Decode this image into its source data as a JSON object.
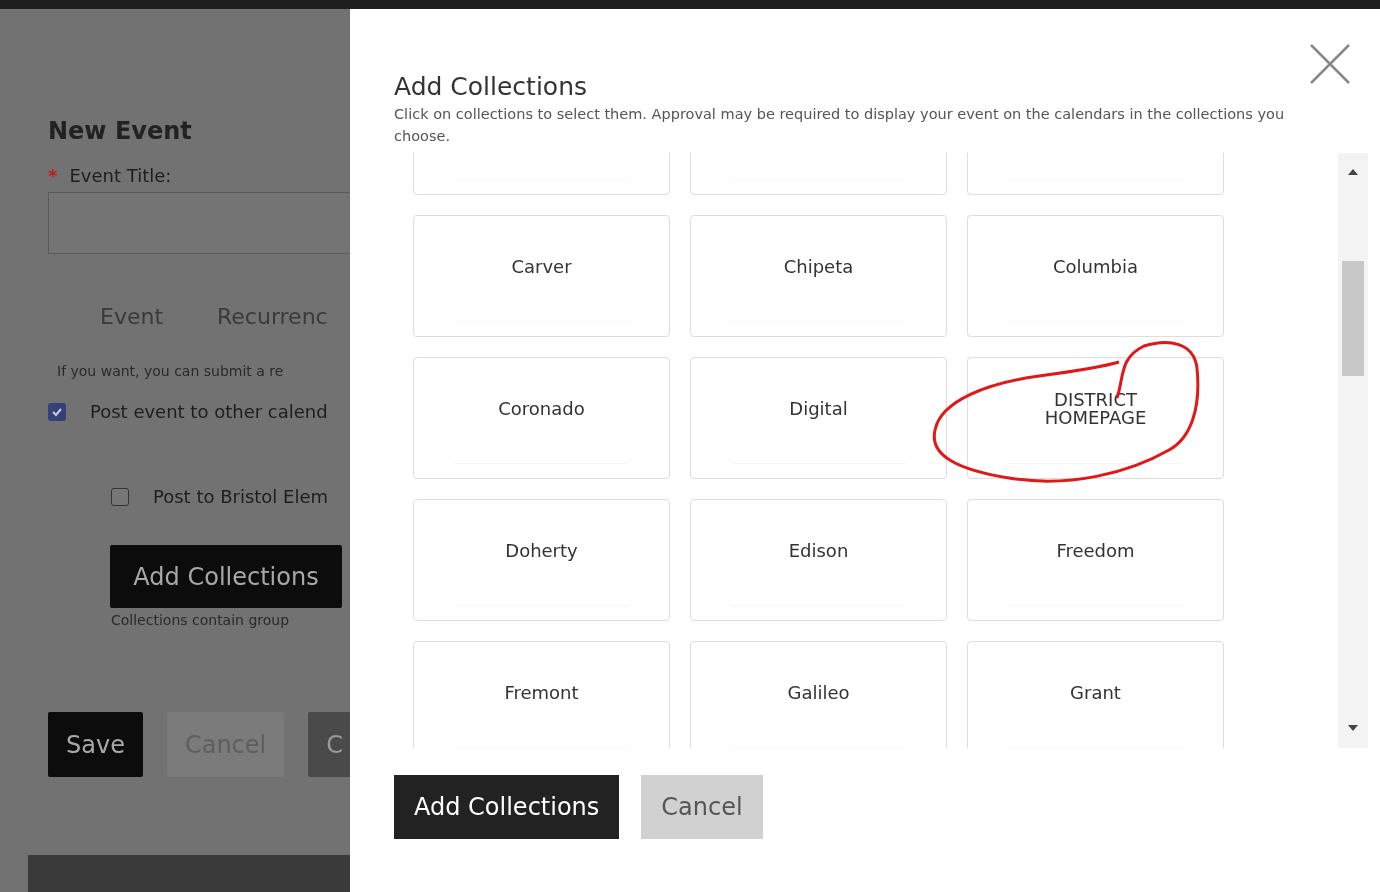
{
  "background_page": {
    "title": "New Event",
    "field_label": "Event Title:",
    "required_mark": "*",
    "tabs": [
      {
        "label": "Event"
      },
      {
        "label": "Recurrenc"
      }
    ],
    "note": "If you want, you can submit a re",
    "checkboxes": [
      {
        "label": "Post event to other calend",
        "checked": true
      },
      {
        "label": "Post to Bristol Elem",
        "checked": false
      }
    ],
    "add_button": "Add Collections",
    "hint": "Collections contain group",
    "buttons": [
      {
        "label": "Save",
        "kind": "primary"
      },
      {
        "label": "Cancel",
        "kind": "secondary"
      },
      {
        "label": "C",
        "kind": "tertiary"
      }
    ]
  },
  "dialog": {
    "title": "Add Collections",
    "description": "Click on collections to select them. Approval may be required to display your event on the calendars in the collections you choose.",
    "collections": [
      {
        "kind": "cut"
      },
      {
        "kind": "cut"
      },
      {
        "kind": "cut"
      },
      {
        "kind": "tile",
        "label": "Carver"
      },
      {
        "kind": "tile",
        "label": "Chipeta"
      },
      {
        "kind": "tile",
        "label": "Columbia"
      },
      {
        "kind": "tile",
        "label": "Coronado"
      },
      {
        "kind": "tile",
        "label": "Digital"
      },
      {
        "kind": "tile",
        "label": "DISTRICT HOMEPAGE",
        "annotated": true
      },
      {
        "kind": "tile",
        "label": "Doherty"
      },
      {
        "kind": "tile",
        "label": "Edison"
      },
      {
        "kind": "tile",
        "label": "Freedom"
      },
      {
        "kind": "tile",
        "label": "Fremont"
      },
      {
        "kind": "tile",
        "label": "Galileo"
      },
      {
        "kind": "tile",
        "label": "Grant"
      }
    ],
    "buttons": [
      {
        "label": "Add Collections",
        "kind": "primary"
      },
      {
        "label": "Cancel",
        "kind": "secondary"
      }
    ]
  }
}
